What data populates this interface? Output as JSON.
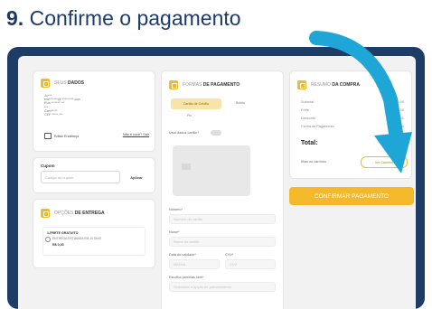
{
  "step": {
    "number": "9.",
    "text": "Confirme o pagamento"
  },
  "dados": {
    "title_prefix": "SEUS",
    "title_bold": "DADOS",
    "line1": "Jo***",
    "line2": "ma*******@**********.com",
    "line3": "Rua ******* ***",
    "line4": "***",
    "line5": "Cam*****",
    "line6": "CEP *****-***",
    "edit_label": "Editar Endereço",
    "nao_label": "Não é você? Sair"
  },
  "cupom": {
    "label": "Cupom",
    "placeholder": "Código do cupom",
    "apply_label": "Aplicar"
  },
  "entrega": {
    "title_prefix": "OPÇÕES",
    "title_bold": "DE ENTREGA",
    "option_name": "1-FRETE GRATUITO",
    "option_desc": "ENTREGA ESTIMADA EM 10 DIAS",
    "option_price": "R$ 0,00"
  },
  "pagamento": {
    "title_prefix": "FORMAS",
    "title_bold": "DE PAGAMENTO",
    "option1": "Cartão de Crédito",
    "option2": "Boleto",
    "option3": "Pix",
    "saved_cards_label": "Usar dados cartão?",
    "field_numero_label": "Número*",
    "field_numero_placeholder": "Número do cartão",
    "field_nome_label": "Nome*",
    "field_nome_placeholder": "Nome do cartão",
    "field_validade_label": "Data de validade*",
    "field_validade_placeholder": "MM/AA",
    "field_cvv_label": "CVV*",
    "field_cvv_placeholder": "CVV",
    "field_parcelas_label": "Escolha parcelas sem*",
    "field_parcelas_placeholder": "Selecione a opção de parcelamento"
  },
  "resumo": {
    "title_prefix": "RESUMO",
    "title_bold": "DA COMPRA",
    "rows": [
      {
        "label": "Subtotal",
        "value": "R$ 00,00"
      },
      {
        "label": "Frete",
        "value": "R$ 0,00"
      },
      {
        "label": "Desconto",
        "value": "R$ 0,00"
      },
      {
        "label": "Forma de Pagamento",
        "value": "Cartão"
      }
    ],
    "total_label": "Total:",
    "total_value": "0,00",
    "keep_label": "Ilhas no carrinho",
    "keep_link": "Ver Carrinho",
    "confirm_label": "CONFIRMAR PAGAMENTO"
  },
  "colors": {
    "accent": "#f3b92a",
    "frame": "#1d3c66",
    "arrow": "#1ea7d6"
  }
}
